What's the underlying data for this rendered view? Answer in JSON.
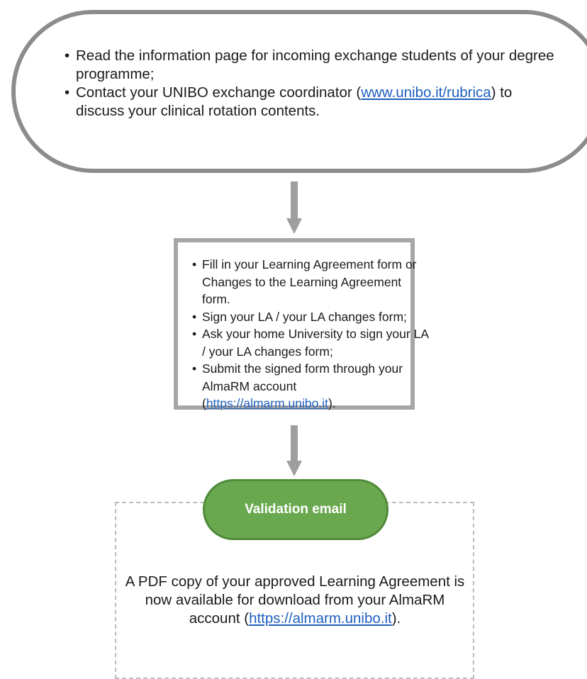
{
  "step1": {
    "items": [
      {
        "text": "Read the information page for incoming exchange students of your degree programme;"
      },
      {
        "prefix": "Contact your UNIBO exchange coordinator (",
        "link": "www.unibo.it/rubrica",
        "suffix": ") to discuss your clinical rotation contents."
      }
    ]
  },
  "step2": {
    "items": [
      {
        "text": "Fill in your Learning Agreement form or Changes to the Learning Agreement form."
      },
      {
        "text": "Sign your LA / your LA changes form;"
      },
      {
        "text": "Ask your home University to sign your LA / your LA changes form;"
      },
      {
        "prefix": "Submit the signed form through your AlmaRM account (",
        "link": "https://almarm.unibo.it",
        "suffix": ")."
      }
    ]
  },
  "step3": {
    "title": "Validation email",
    "prefix": "A PDF copy of your approved Learning Agreement is now available for download from your AlmaRM account (",
    "link": "https://almarm.unibo.it",
    "suffix": ")."
  },
  "colors": {
    "border_gray": "#8c8c8c",
    "arrow_gray": "#9e9e9e",
    "green_fill": "#6aa84f",
    "link_blue": "#1f5fbf"
  }
}
